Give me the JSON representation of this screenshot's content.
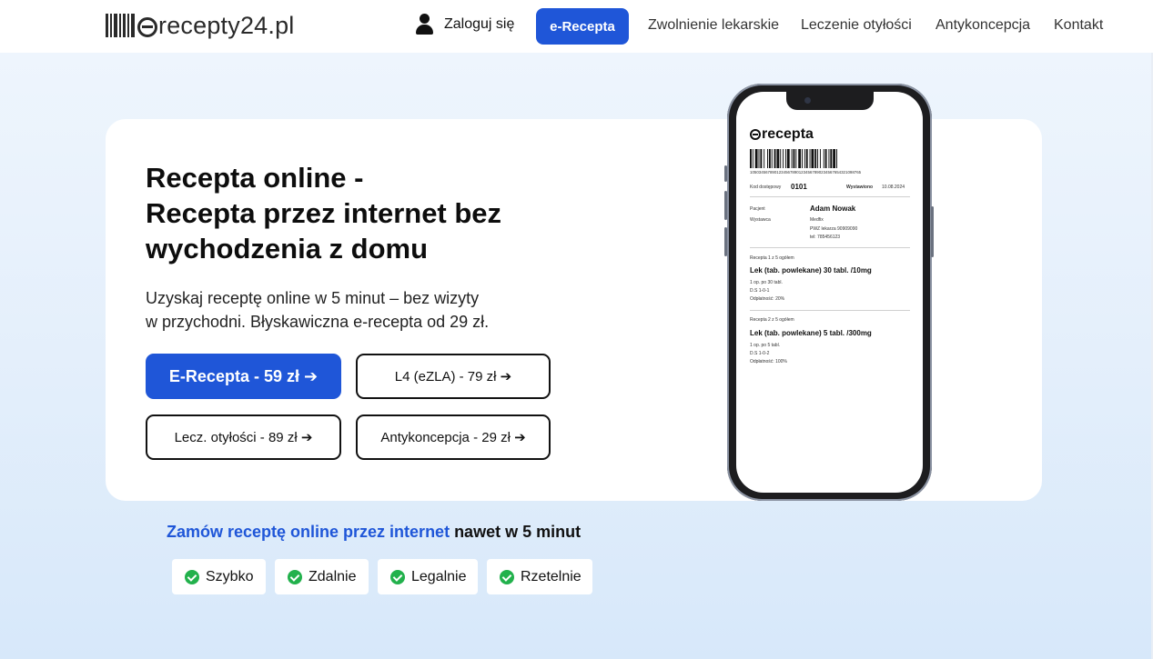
{
  "header": {
    "logo_text": "recepty24.pl",
    "login_label": "Zaloguj się",
    "cta_label": "e-Recepta",
    "nav": [
      {
        "label": "Zwolnienie lekarskie"
      },
      {
        "label": "Leczenie otyłości"
      },
      {
        "label": "Antykoncepcja"
      },
      {
        "label": "Kontakt"
      }
    ]
  },
  "hero": {
    "title_lines": [
      "Recepta online -",
      "Recepta przez internet bez",
      "wychodzenia z domu"
    ],
    "subtitle_lines": [
      "Uzyskaj receptę online w 5 minut – bez wizyty",
      "w przychodni. Błyskawiczna e-recepta od 29 zł."
    ],
    "buttons": [
      {
        "label": "E-Recepta - 59 zł ➔"
      },
      {
        "label": "L4 (eZLA) - 79 zł ➔"
      },
      {
        "label": "Lecz. otyłości - 89 zł ➔"
      },
      {
        "label": "Antykoncepcja - 29 zł ➔"
      }
    ]
  },
  "prescription": {
    "logo_text": "recepta",
    "barcode_number": "10503456789012345678901234567890234567654321098765",
    "access_code_label": "Kod dostępowy",
    "access_code": "0101",
    "issued_label": "Wystawiono",
    "issued_date": "10.08.2024",
    "patient_label": "Pacjent",
    "patient_name": "Adam Nowak",
    "issuer_label": "Wystawca",
    "issuer_lines": [
      "Medfix",
      "PWZ lekarza 90909090",
      "tel: 785456123"
    ],
    "items": [
      {
        "header": "Recepta 1 z 5 ogółem",
        "drug": "Lek (tab. powlekane) 30 tabl. /10mg",
        "lines": [
          "1 op. po 30 tabl.",
          "D.S 1-0-1",
          "Odpłatność: 20%"
        ]
      },
      {
        "header": "Recepta 2 z 5 ogółem",
        "drug": "Lek (tab. powlekane) 5 tabl. /300mg",
        "lines": [
          "1 op. po 5 tabl.",
          "D.S 1-0-2",
          "Odpłatność: 100%"
        ]
      }
    ]
  },
  "tagline": {
    "highlight": "Zamów receptę online przez internet",
    "rest": " nawet w 5 minut"
  },
  "features": [
    {
      "label": "Szybko"
    },
    {
      "label": "Zdalnie"
    },
    {
      "label": "Legalnie"
    },
    {
      "label": "Rzetelnie"
    }
  ],
  "colors": {
    "accent": "#1f56d8",
    "check": "#22b14c"
  }
}
